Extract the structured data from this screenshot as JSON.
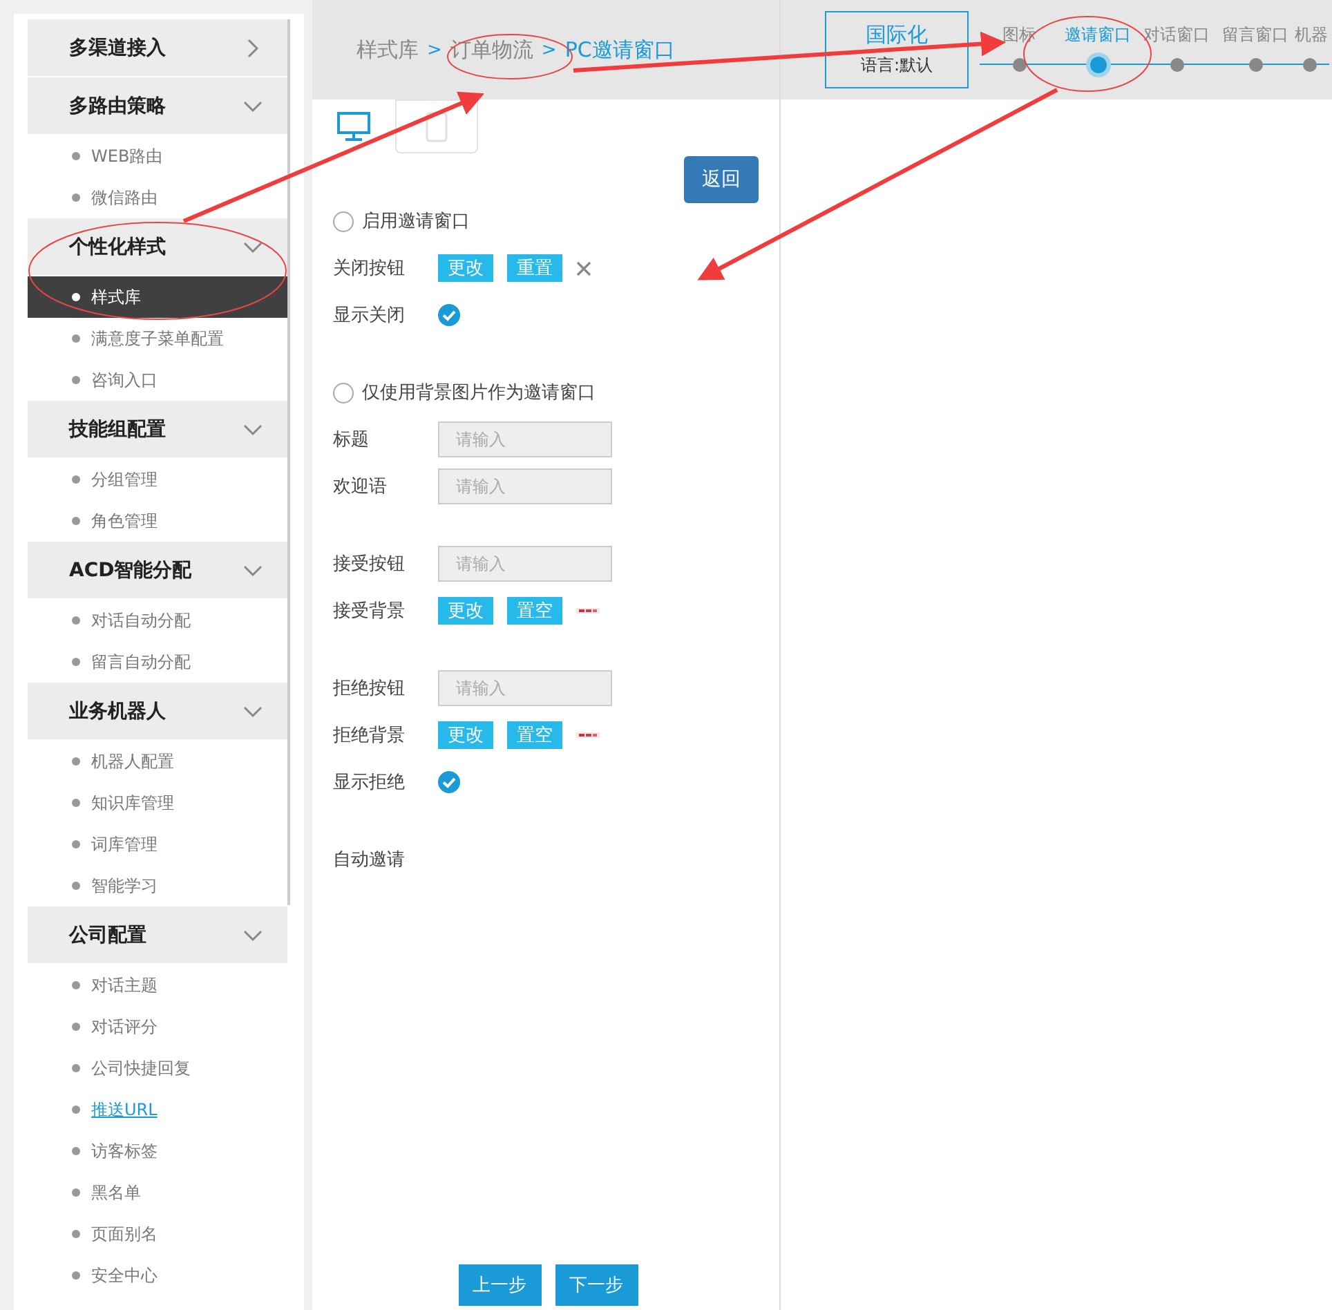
{
  "sidebar": {
    "groups": [
      {
        "title": "多渠道接入",
        "expanded": false
      },
      {
        "title": "多路由策略",
        "expanded": true,
        "items": [
          {
            "label": "WEB路由",
            "selected": false,
            "kind": "item"
          },
          {
            "label": "微信路由",
            "selected": false,
            "kind": "item"
          }
        ]
      },
      {
        "title": "个性化样式",
        "expanded": true,
        "items": [
          {
            "label": "样式库",
            "selected": true,
            "kind": "item"
          },
          {
            "label": "满意度子菜单配置",
            "selected": false,
            "kind": "item"
          },
          {
            "label": "咨询入口",
            "selected": false,
            "kind": "item"
          }
        ]
      },
      {
        "title": "技能组配置",
        "expanded": true,
        "items": [
          {
            "label": "分组管理",
            "selected": false,
            "kind": "item"
          },
          {
            "label": "角色管理",
            "selected": false,
            "kind": "item"
          }
        ]
      },
      {
        "title": "ACD智能分配",
        "expanded": true,
        "items": [
          {
            "label": "对话自动分配",
            "selected": false,
            "kind": "item"
          },
          {
            "label": "留言自动分配",
            "selected": false,
            "kind": "item"
          }
        ]
      },
      {
        "title": "业务机器人",
        "expanded": true,
        "items": [
          {
            "label": "机器人配置",
            "selected": false,
            "kind": "item"
          },
          {
            "label": "知识库管理",
            "selected": false,
            "kind": "item"
          },
          {
            "label": "词库管理",
            "selected": false,
            "kind": "item"
          },
          {
            "label": "智能学习",
            "selected": false,
            "kind": "item"
          }
        ]
      },
      {
        "title": "公司配置",
        "expanded": true,
        "items": [
          {
            "label": "对话主题",
            "selected": false,
            "kind": "item"
          },
          {
            "label": "对话评分",
            "selected": false,
            "kind": "item"
          },
          {
            "label": "公司快捷回复",
            "selected": false,
            "kind": "item"
          },
          {
            "label": "推送URL",
            "selected": false,
            "kind": "link"
          },
          {
            "label": "访客标签",
            "selected": false,
            "kind": "item"
          },
          {
            "label": "黑名单",
            "selected": false,
            "kind": "item"
          },
          {
            "label": "页面别名",
            "selected": false,
            "kind": "item"
          },
          {
            "label": "安全中心",
            "selected": false,
            "kind": "item"
          }
        ]
      }
    ]
  },
  "breadcrumb": [
    {
      "label": "样式库",
      "kind": "crumb",
      "current": false
    },
    {
      "label": ">",
      "kind": "sep"
    },
    {
      "label": "订单物流",
      "kind": "crumb",
      "current": false
    },
    {
      "label": ">",
      "kind": "sep"
    },
    {
      "label": "PC邀请窗口",
      "kind": "crumb",
      "current": true
    }
  ],
  "i18n": {
    "title": "国际化",
    "language": "语言:默认"
  },
  "steps": [
    {
      "label": "图标",
      "selected": false
    },
    {
      "label": "邀请窗口",
      "selected": true
    },
    {
      "label": "对话窗口",
      "selected": false
    },
    {
      "label": "留言窗口",
      "selected": false
    },
    {
      "label": "机器",
      "selected": false
    }
  ],
  "device_tabs": [
    {
      "kind": "desktop",
      "selected": true
    },
    {
      "kind": "mobile",
      "selected": false
    }
  ],
  "back_button": "返回",
  "sections": [
    [
      {
        "kind": "radio",
        "label": "启用邀请窗口",
        "checked": false
      },
      {
        "kind": "buttons",
        "label": "关闭按钮",
        "buttons": [
          "更改",
          "重置"
        ],
        "extra": {
          "kind": "close"
        }
      },
      {
        "kind": "check",
        "label": "显示关闭",
        "checked": true
      }
    ],
    [
      {
        "kind": "radio",
        "label": "仅使用背景图片作为邀请窗口",
        "checked": false
      },
      {
        "kind": "input",
        "label": "标题",
        "placeholder": "请输入"
      },
      {
        "kind": "input",
        "label": "欢迎语",
        "placeholder": "请输入"
      }
    ],
    [
      {
        "kind": "input",
        "label": "接受按钮",
        "placeholder": "请输入"
      },
      {
        "kind": "buttons",
        "label": "接受背景",
        "buttons": [
          "更改",
          "置空"
        ],
        "extra": {
          "kind": "picture"
        }
      }
    ],
    [
      {
        "kind": "input",
        "label": "拒绝按钮",
        "placeholder": "请输入"
      },
      {
        "kind": "buttons",
        "label": "拒绝背景",
        "buttons": [
          "更改",
          "置空"
        ],
        "extra": {
          "kind": "picture"
        }
      },
      {
        "kind": "check",
        "label": "显示拒绝",
        "checked": true
      }
    ],
    [
      {
        "kind": "text",
        "label": "自动邀请"
      }
    ]
  ],
  "footer_buttons": [
    "上一步",
    "下一步"
  ]
}
